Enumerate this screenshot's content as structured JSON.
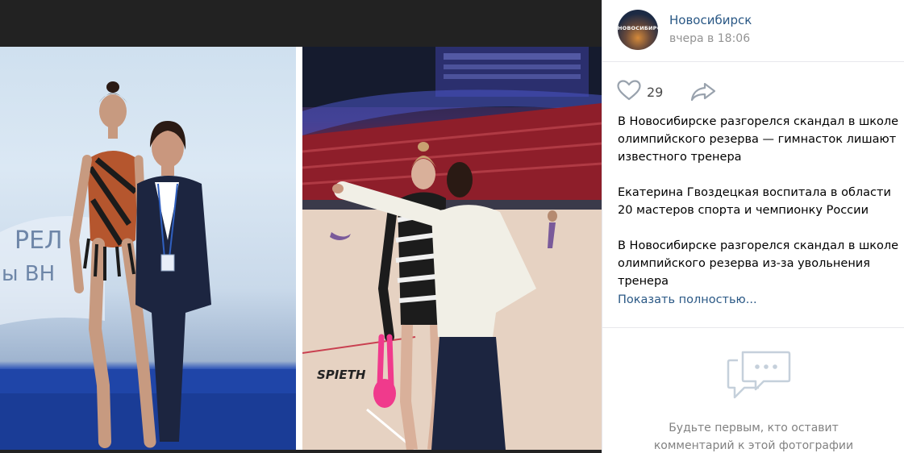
{
  "post": {
    "author": "Новосибирск",
    "time": "вчера в 18:06",
    "avatar_text": "НОВОСИБИРСК",
    "likes": "29",
    "paragraphs": [
      "В Новосибирске разгорелся скандал в школе олимпийского резерва — гимнасток лишают известного тренера",
      "Екатерина Гвоздецкая воспитала в области 20 мастеров спорта и чемпионку России",
      "В Новосибирске разгорелся скандал в школе олимпийского резерва из-за увольнения тренера"
    ],
    "show_more": "Показать полностью..."
  },
  "comments": {
    "empty_line1": "Будьте первым, кто оставит",
    "empty_line2": "комментарий к этой фотографии"
  },
  "photo": {
    "left_banner_line1": "РЕЛ",
    "left_banner_line2": "ы ВН",
    "right_mat_brand": "SPIETH"
  },
  "icons": {
    "like": "heart-icon",
    "share": "share-arrow-icon",
    "comments": "speech-bubbles-icon"
  },
  "colors": {
    "link": "#2a5885",
    "muted": "#939393",
    "border": "#e7e8ec"
  }
}
